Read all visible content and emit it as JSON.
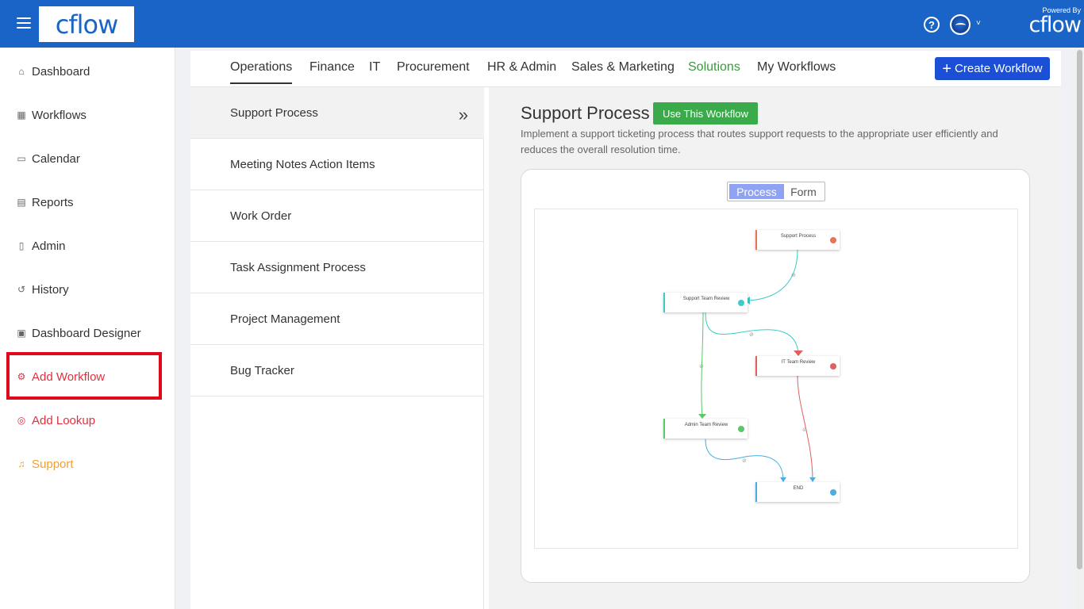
{
  "header": {
    "logo_text": "cflow",
    "powered_by": "Powered By",
    "powered_brand": "cflow",
    "help_icon": "question-circle-icon",
    "avatar_icon": "user-avatar",
    "avatar_caret": "˅"
  },
  "sidebar": {
    "items": [
      {
        "label": "Dashboard",
        "icon": "home-icon",
        "glyph": "⌂"
      },
      {
        "label": "Workflows",
        "icon": "grid-icon",
        "glyph": "▦"
      },
      {
        "label": "Calendar",
        "icon": "calendar-icon",
        "glyph": "▭"
      },
      {
        "label": "Reports",
        "icon": "report-icon",
        "glyph": "▤"
      },
      {
        "label": "Admin",
        "icon": "book-icon",
        "glyph": "▯"
      },
      {
        "label": "History",
        "icon": "history-icon",
        "glyph": "↺"
      },
      {
        "label": "Dashboard Designer",
        "icon": "designer-icon",
        "glyph": "▣"
      },
      {
        "label": "Add Workflow",
        "icon": "hierarchy-icon",
        "glyph": "⚙"
      },
      {
        "label": "Add Lookup",
        "icon": "target-icon",
        "glyph": "◎"
      },
      {
        "label": "Support",
        "icon": "headset-icon",
        "glyph": "♫"
      }
    ]
  },
  "tabs": [
    "Operations",
    "Finance",
    "IT",
    "Procurement",
    "HR & Admin",
    "Sales & Marketing",
    "Solutions",
    "My Workflows"
  ],
  "create_button": {
    "plus": "+",
    "label": "Create Workflow"
  },
  "templates": [
    "Support Process",
    "Meeting Notes Action Items",
    "Work Order",
    "Task Assignment Process",
    "Project Management",
    "Bug Tracker"
  ],
  "selected_chevron": "»",
  "detail": {
    "title": "Support Process",
    "use_button": "Use This Workflow",
    "description": "Implement a support ticketing process that routes support requests to the appropriate user efficiently and reduces the overall resolution time.",
    "toggle": {
      "process": "Process",
      "form": "Form"
    }
  },
  "diagram": {
    "nodes": [
      {
        "label": "Support Process",
        "accent": "#e8735a",
        "dot": "#e8735a"
      },
      {
        "label": "Support Team Review",
        "accent": "#3ecbc8",
        "dot": "#3ecbc8"
      },
      {
        "label": "IT Team Review",
        "accent": "#e06060",
        "dot": "#e06060"
      },
      {
        "label": "Admin Team Review",
        "accent": "#5cc66a",
        "dot": "#5cc66a"
      },
      {
        "label": "END",
        "accent": "#4aaee0",
        "dot": "#4aaee0"
      }
    ]
  },
  "colors": {
    "topbar": "#1a64c7",
    "create_button": "#1a4fd6",
    "use_button": "#3aaa4a",
    "highlight": "#e0091b"
  }
}
